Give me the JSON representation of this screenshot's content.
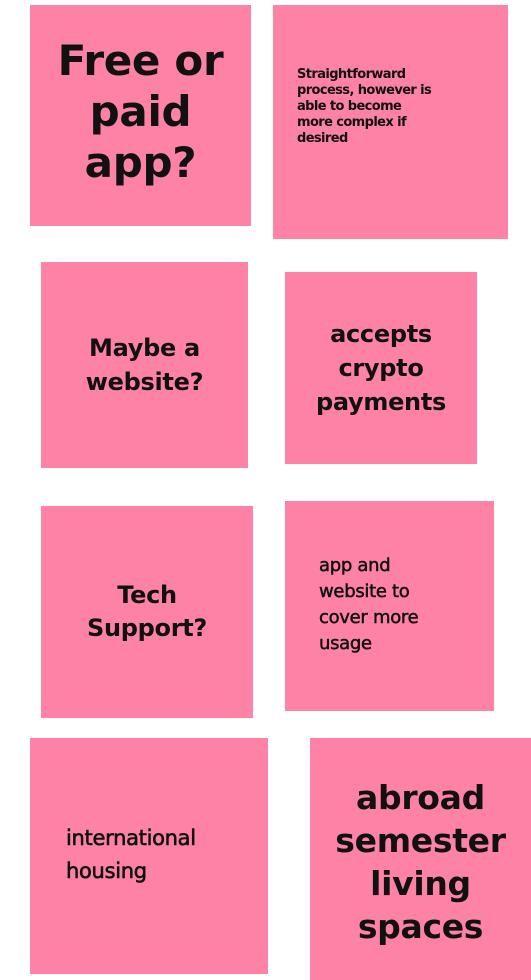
{
  "notes": [
    {
      "text": "Free or\npaid\napp?"
    },
    {
      "text": "Straightforward\nprocess, however is\nable to become\nmore complex if\ndesired"
    },
    {
      "text": "Maybe a\nwebsite?"
    },
    {
      "text": "accepts\ncrypto\npayments"
    },
    {
      "text": "Tech\nSupport?"
    },
    {
      "text": "app and\nwebsite to\ncover more\nusage"
    },
    {
      "text": "international\nhousing"
    },
    {
      "text": "abroad\nsemester\nliving\nspaces"
    }
  ],
  "colors": {
    "note_background": "#fe82a5",
    "text": "#111111",
    "page_background": "#ffffff"
  }
}
